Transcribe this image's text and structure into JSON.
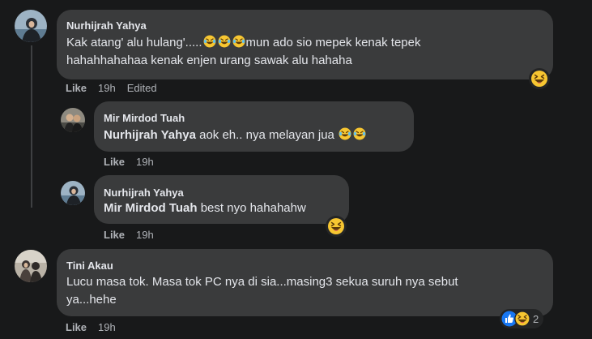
{
  "comments": [
    {
      "author": "Nurhijrah Yahya",
      "line1_pre": "Kak atang' alu hulang'.....",
      "line1_post": "mun ado sio mepek kenak tepek",
      "line2": "hahahhahahaa kenak enjen urang sawak alu hahaha",
      "like": "Like",
      "time": "19h",
      "edited": "Edited",
      "reaction_icon": "laughing-squint-emoji"
    },
    {
      "author": "Mir Mirdod Tuah",
      "mention": "Nurhijrah Yahya",
      "text": " aok eh.. nya melayan jua ",
      "like": "Like",
      "time": "19h"
    },
    {
      "author": "Nurhijrah Yahya",
      "mention": "Mir Mirdod Tuah",
      "text": " best nyo hahahahw",
      "like": "Like",
      "time": "19h",
      "reaction_icon": "laughing-squint-emoji"
    },
    {
      "author": "Tini Akau",
      "line1": "Lucu masa tok. Masa tok PC nya di sia...masing3 sekua suruh nya sebut",
      "line2": "ya...hehe",
      "like": "Like",
      "time": "19h",
      "reaction_count": "2",
      "reaction_icons": [
        "like-reaction-icon",
        "laughing-squint-emoji"
      ]
    }
  ],
  "colors": {
    "background": "#18191a",
    "bubble": "#3a3b3c",
    "text": "#e4e6eb",
    "secondary_text": "#b0b3b8",
    "like_blue": "#1877f2",
    "emoji_yellow": "#f7c631"
  }
}
